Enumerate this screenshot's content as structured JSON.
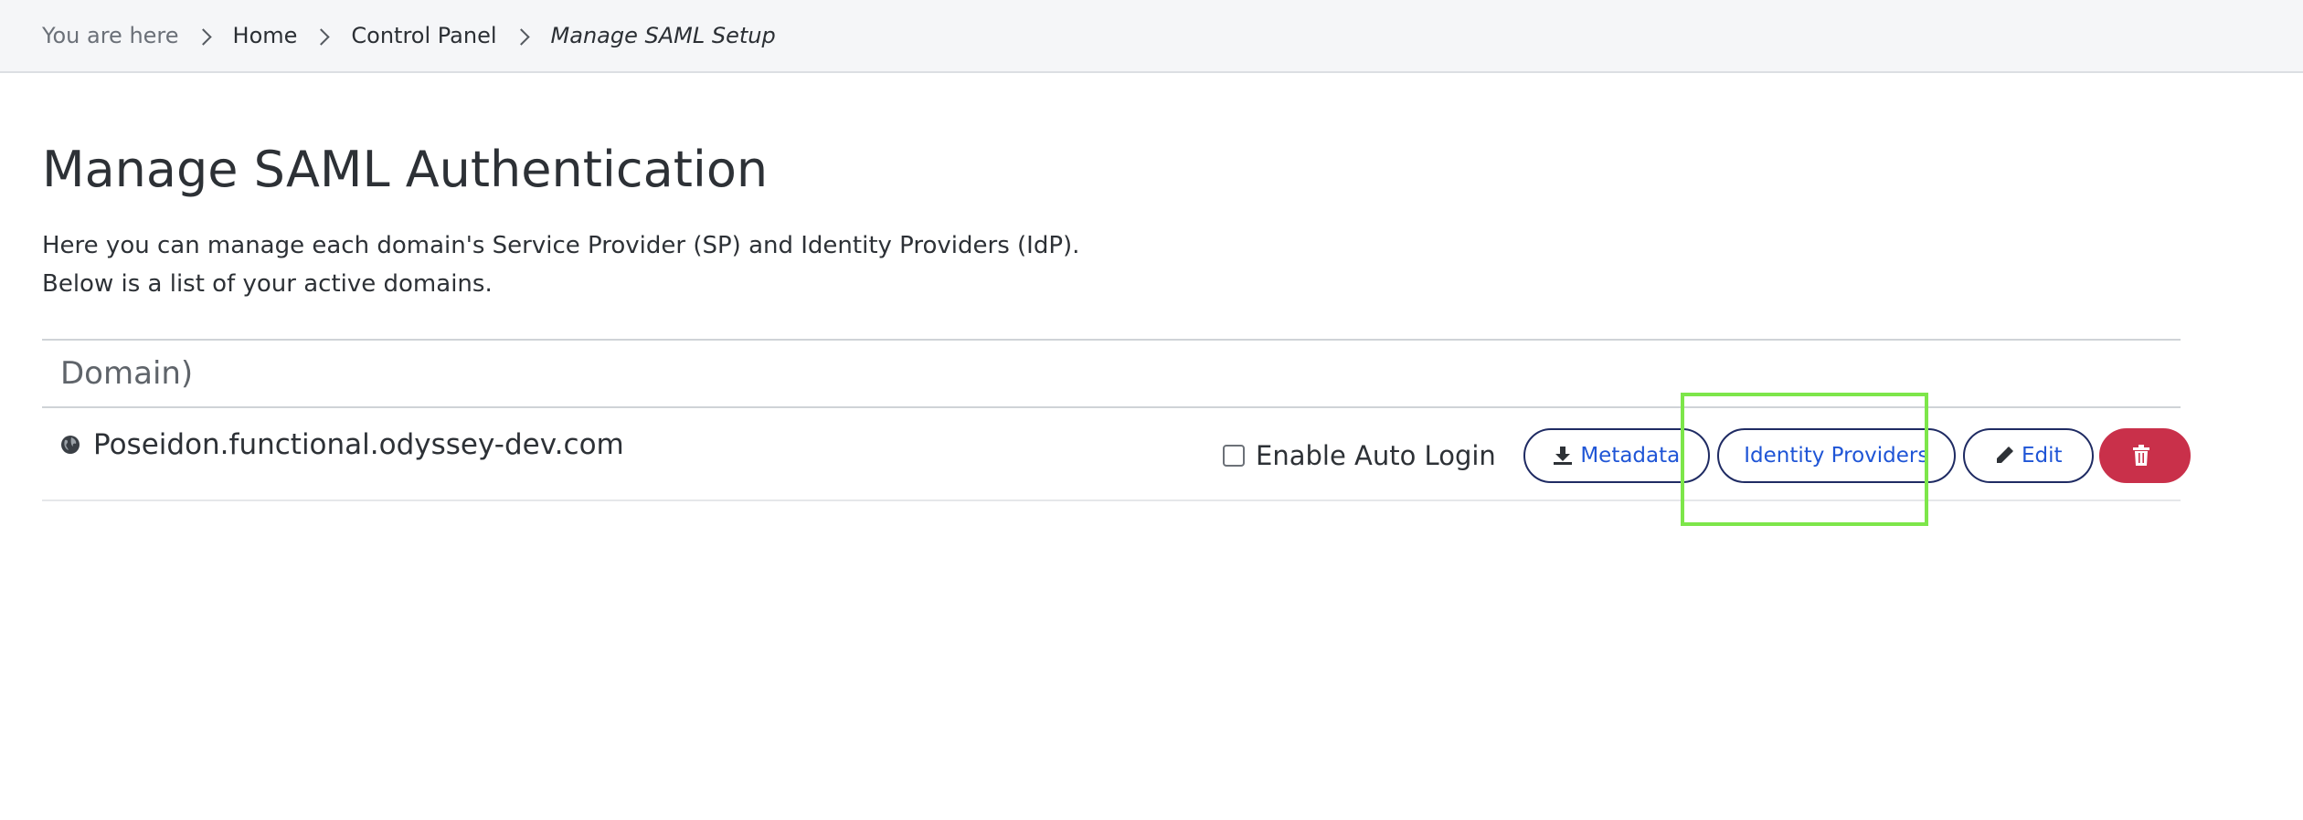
{
  "breadcrumb": {
    "prefix": "You are here",
    "items": [
      {
        "label": "Home"
      },
      {
        "label": "Control Panel"
      }
    ],
    "current": "Manage SAML Setup"
  },
  "page": {
    "title": "Manage SAML Authentication",
    "intro_line1": "Here you can manage each domain's Service Provider (SP) and Identity Providers (IdP).",
    "intro_line2": "Below is a list of your active domains."
  },
  "table": {
    "header_domain": "Domain)",
    "rows": [
      {
        "domain": "Poseidon.functional.odyssey-dev.com",
        "auto_login_label": "Enable Auto Login",
        "auto_login_checked": false,
        "metadata_label": "Metadata",
        "idp_label": "Identity Providers",
        "edit_label": "Edit",
        "icons": [
          "globe-icon",
          "download-icon",
          "pencil-icon",
          "trash-icon"
        ]
      }
    ]
  },
  "colors": {
    "accent_link": "#1f55d6",
    "button_border": "#1f2b63",
    "danger": "#c9304a",
    "highlight": "#7de64a"
  }
}
